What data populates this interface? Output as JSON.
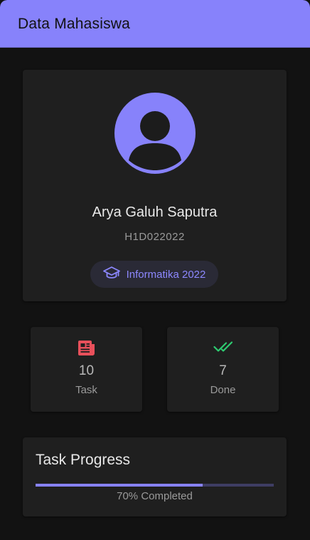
{
  "appbar": {
    "title": "Data Mahasiswa",
    "color": "#8782fb"
  },
  "profile": {
    "avatar_icon": "account-circle-icon",
    "name": "Arya Galuh Saputra",
    "nim": "H1D022022",
    "chip": {
      "icon": "graduation-cap-icon",
      "label": "Informatika 2022",
      "color": "#8d88ff"
    }
  },
  "stats": [
    {
      "icon": "newspaper-icon",
      "icon_color": "#e8505b",
      "value": "10",
      "label": "Task"
    },
    {
      "icon": "double-check-icon",
      "icon_color": "#2ecc71",
      "value": "7",
      "label": "Done"
    }
  ],
  "progress": {
    "title": "Task Progress",
    "fraction": 0.7,
    "text": "70% Completed",
    "fill_color": "#8782fb",
    "track_color": "#3e3d63"
  }
}
